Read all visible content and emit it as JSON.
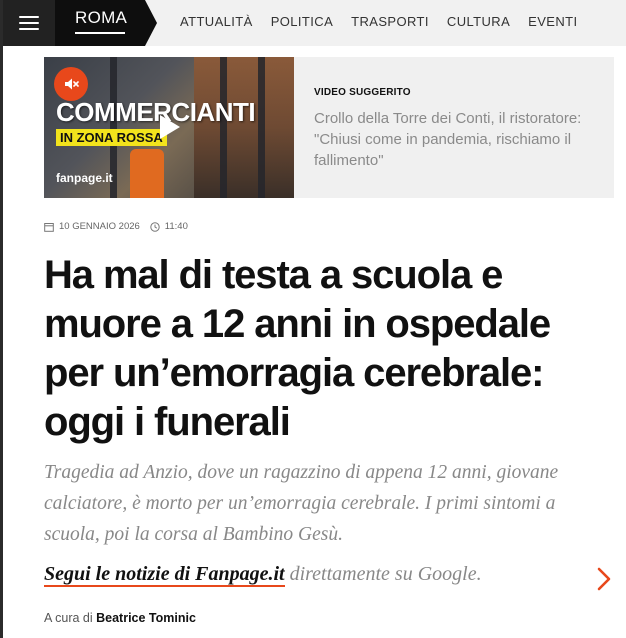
{
  "nav": {
    "city": "ROMA",
    "links": [
      "ATTUALITÀ",
      "POLITICA",
      "TRASPORTI",
      "CULTURA",
      "EVENTI"
    ]
  },
  "video": {
    "promo_title": "COMMERCIANTI",
    "promo_subtitle": "IN ZONA ROSSA",
    "brand": "fanpage.it",
    "kicker": "VIDEO SUGGERITO",
    "title": "Crollo della Torre dei Conti, il ristoratore: \"Chiusi come in pandemia, rischiamo il fallimento\""
  },
  "article": {
    "date": "10 GENNAIO 2026",
    "time": "11:40",
    "headline": "Ha mal di testa a scuola e muore a 12 anni in ospedale per un’emorragia cerebrale: oggi i funerali",
    "summary": "Tragedia ad Anzio, dove un ragazzino di appena 12 anni, giovane calciatore, è morto per un’emorragia cerebrale. I primi sintomi a scuola, poi la corsa al Bambino Gesù.",
    "follow_link": "Segui le notizie di Fanpage.it",
    "follow_rest": " direttamente su Google.",
    "byline_prefix": "A cura di ",
    "author": "Beatrice Tominic"
  },
  "colors": {
    "accent": "#e8481b",
    "nav_bg": "#f1f1f1",
    "city_bg": "#0e0e0e",
    "summary_text": "#888888"
  },
  "icons": [
    "menu-icon",
    "mute-icon",
    "play-icon",
    "calendar-icon",
    "clock-icon",
    "chevron-right-icon"
  ]
}
